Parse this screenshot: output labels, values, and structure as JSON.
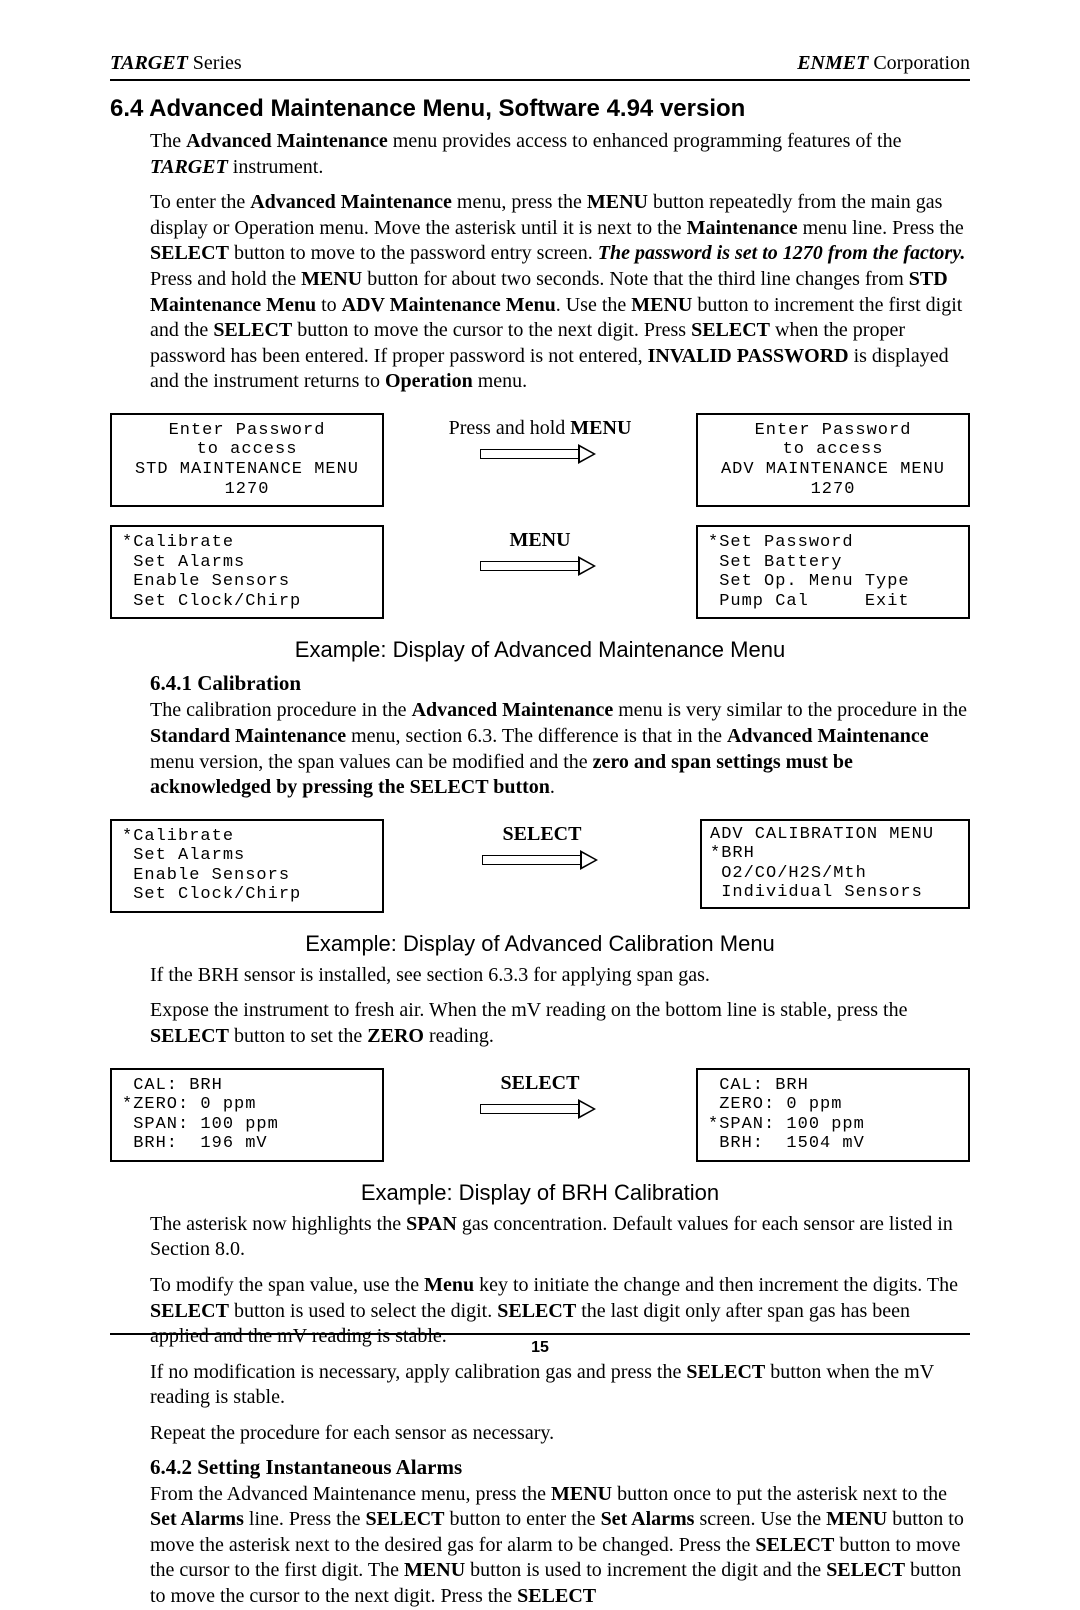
{
  "header": {
    "left_brand": "TARGET",
    "left_suffix": "  Series",
    "right_brand": "ENMET",
    "right_suffix": " Corporation"
  },
  "section": {
    "heading": "6.4 Advanced Maintenance Menu, Software 4.94 version",
    "p1a": "The ",
    "p1b": "Advanced Maintenance",
    "p1c": " menu provides access to enhanced programming features of the ",
    "p1d": "TARGET",
    "p1e": " instrument.",
    "p2a": "To enter the ",
    "p2b": "Advanced Maintenance",
    "p2c": " menu, press the ",
    "p2d": "MENU",
    "p2e": " button repeatedly from the main gas display or Operation menu.  Move the asterisk until it is next to the ",
    "p2f": "Maintenance",
    "p2g": " menu line.  Press the ",
    "p2h": "SELECT",
    "p2i": " button to move to the password entry screen.  ",
    "p2j": "The password is set to 1270 from the factory.",
    "p2k": "  Press and hold the ",
    "p2l": "MENU",
    "p2m": " button for about two seconds.  Note that the third line changes from ",
    "p2n": "STD Maintenance Menu",
    "p2o": " to ",
    "p2p": "ADV Maintenance Menu",
    "p2q": ".  Use the ",
    "p2r": "MENU",
    "p2s": " button to increment the first digit and the ",
    "p2t": "SELECT",
    "p2u": " button to move the cursor to the next digit.  Press ",
    "p2v": "SELECT",
    "p2w": " when the proper password has been entered.  If proper password is not entered, ",
    "p2x": "INVALID PASSWORD",
    "p2y": " is displayed and the instrument returns to ",
    "p2z": "Operation",
    "p2aa": " menu."
  },
  "row1": {
    "left": "Enter Password\nto access\nSTD MAINTENANCE MENU\n1270",
    "mid_a": "Press and hold ",
    "mid_b": "MENU",
    "right": "Enter Password\nto access\nADV MAINTENANCE MENU\n1270"
  },
  "row2": {
    "left": "*Calibrate\n Set Alarms\n Enable Sensors\n Set Clock/Chirp",
    "mid": "MENU",
    "right": "*Set Password\n Set Battery\n Set Op. Menu Type\n Pump Cal     Exit"
  },
  "caption1": "Example: Display of Advanced Maintenance Menu",
  "sub1": {
    "heading": "6.4.1 Calibration",
    "p1a": "The calibration procedure in the ",
    "p1b": "Advanced Maintenance",
    "p1c": " menu is very similar to the procedure in the ",
    "p1d": "Standard Maintenance",
    "p1e": " menu, section 6.3.  The difference is that in the ",
    "p1f": "Advanced Maintenance",
    "p1g": " menu version, the span values can be modified and the ",
    "p1h": "zero and span settings must be acknowledged by pressing the SELECT button",
    "p1i": "."
  },
  "row3": {
    "left": "*Calibrate\n Set Alarms\n Enable Sensors\n Set Clock/Chirp",
    "mid": "SELECT",
    "right": "ADV CALIBRATION MENU\n*BRH\n O2/CO/H2S/Mth\n Individual Sensors"
  },
  "caption2": "Example: Display of Advanced Calibration Menu",
  "p3": "If the BRH sensor is installed, see section 6.3.3 for applying span gas.",
  "p4a": "Expose the instrument to fresh air.  When the mV reading on the bottom line is stable, press the ",
  "p4b": "SELECT",
  "p4c": " button to set the ",
  "p4d": "ZERO",
  "p4e": " reading.",
  "row4": {
    "left": " CAL: BRH\n*ZERO: 0 ppm\n SPAN: 100 ppm\n BRH:  196 mV",
    "mid": "SELECT",
    "right": " CAL: BRH\n ZERO: 0 ppm\n*SPAN: 100 ppm\n BRH:  1504 mV"
  },
  "caption3": "Example: Display of BRH Calibration",
  "p5a": "The asterisk now highlights the ",
  "p5b": "SPAN",
  "p5c": " gas concentration.  Default values for each sensor are listed in Section 8.0.",
  "p6a": "To modify the span value, use the ",
  "p6b": "Menu",
  "p6c": " key to initiate the change and then increment the digits.  The ",
  "p6d": "SELECT",
  "p6e": " button is used to select the digit.  ",
  "p6f": "SELECT",
  "p6g": " the last digit only after span gas has been applied and the mV reading is stable.",
  "p7a": "If no modification is necessary, apply calibration gas and press the ",
  "p7b": "SELECT",
  "p7c": " button when the mV reading is stable.",
  "p8": "Repeat the procedure for each sensor as necessary.",
  "sub2": {
    "heading": "6.4.2 Setting Instantaneous Alarms",
    "p1a": "From the Advanced Maintenance menu, press the ",
    "p1b": "MENU",
    "p1c": " button once to put the asterisk next to the ",
    "p1d": "Set Alarms",
    "p1e": " line.  Press the ",
    "p1f": "SELECT",
    "p1g": " button to enter the ",
    "p1h": "Set Alarms",
    "p1i": " screen.  Use the ",
    "p1j": "MENU",
    "p1k": " button to move the asterisk next to the desired gas for alarm to be changed.  Press the ",
    "p1l": "SELECT",
    "p1m": " button to move the cursor to the first digit.  The ",
    "p1n": "MENU",
    "p1o": " button is used to increment the digit and the ",
    "p1p": "SELECT",
    "p1q": " button to move the cursor to the next digit.  Press the ",
    "p1r": "SELECT"
  },
  "page_number": "15"
}
